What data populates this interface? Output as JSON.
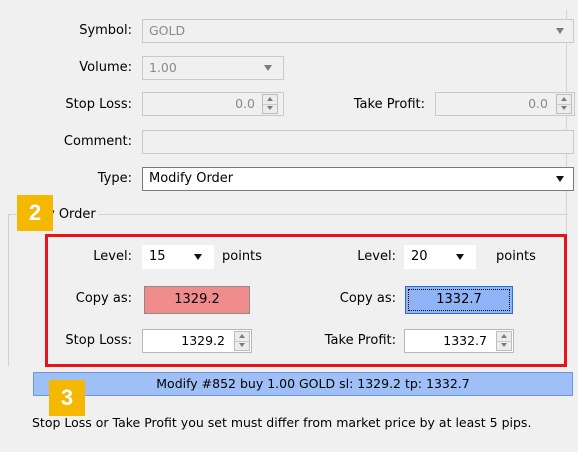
{
  "order_form": {
    "symbol": {
      "label": "Symbol:",
      "value": "GOLD"
    },
    "volume": {
      "label": "Volume:",
      "value": "1.00"
    },
    "stop_loss": {
      "label": "Stop Loss:",
      "value": "0.0"
    },
    "take_profit": {
      "label": "Take Profit:",
      "value": "0.0"
    },
    "comment": {
      "label": "Comment:",
      "value": ""
    },
    "type": {
      "label": "Type:",
      "value": "Modify Order"
    }
  },
  "modify_group": {
    "title": "y Order",
    "left": {
      "level_label": "Level:",
      "level_value": "15",
      "level_unit": "points",
      "copy_label": "Copy as:",
      "copy_value": "1329.2",
      "sl_label": "Stop Loss:",
      "sl_value": "1329.2"
    },
    "right": {
      "level_label": "Level:",
      "level_value": "20",
      "level_unit": "points",
      "copy_label": "Copy as:",
      "copy_value": "1332.7",
      "tp_label": "Take Profit:",
      "tp_value": "1332.7"
    },
    "modify_button": "Modify #852 buy 1.00 GOLD sl: 1329.2 tp: 1332.7"
  },
  "footer_note": "Stop Loss or Take Profit you set must differ from market price by at least 5 pips.",
  "badges": [
    "2",
    "3"
  ],
  "colors": {
    "copy_left_bg": "#f08c8c",
    "copy_right_bg": "#8fb4f5",
    "modify_button_bg": "#9fc0f7",
    "highlight_border": "#e8141c",
    "badge_bg": "#f5b800"
  },
  "icons": [
    "chevron-down-icon",
    "spin-up-icon",
    "spin-down-icon"
  ]
}
